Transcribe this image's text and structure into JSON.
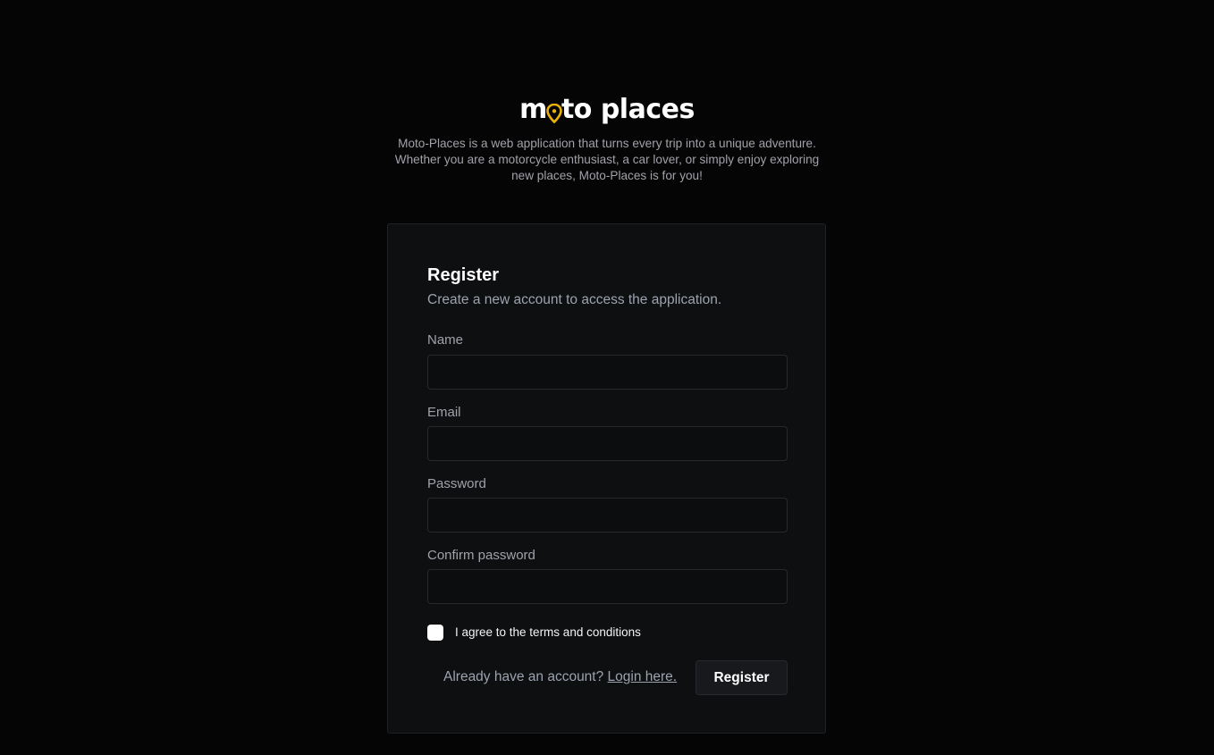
{
  "brand": {
    "part1": "m",
    "part2": "to places",
    "pin_icon": "map-pin-icon",
    "accent_color": "#e9b10a"
  },
  "intro": "Moto-Places is a web application that turns every trip into a unique adventure. Whether you are a motorcycle enthusiast, a car lover, or simply enjoy exploring new places, Moto-Places is for you!",
  "form": {
    "title": "Register",
    "subtitle": "Create a new account to access the application.",
    "fields": [
      {
        "label": "Name",
        "value": "",
        "placeholder": ""
      },
      {
        "label": "Email",
        "value": "",
        "placeholder": ""
      },
      {
        "label": "Password",
        "value": "",
        "placeholder": ""
      },
      {
        "label": "Confirm password",
        "value": "",
        "placeholder": ""
      }
    ],
    "terms_label": "I agree to the terms and conditions",
    "terms_checked": false,
    "footer_prompt": "Already have an account?",
    "login_link": "Login here.",
    "submit_label": "Register"
  }
}
